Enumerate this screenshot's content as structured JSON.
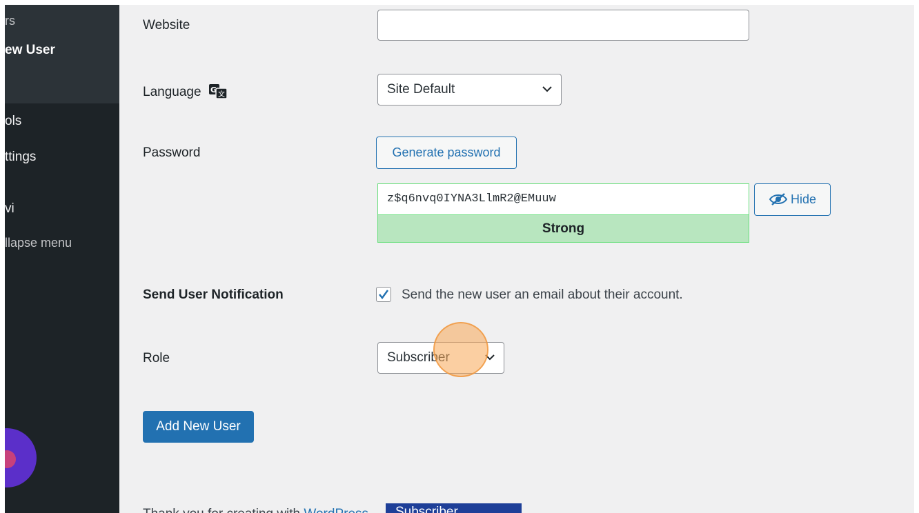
{
  "sidebar": {
    "items": [
      {
        "label": "rs"
      },
      {
        "label": "ew User"
      },
      {
        "label": "ols"
      },
      {
        "label": "ttings"
      },
      {
        "label": "vi"
      },
      {
        "label": "llapse menu"
      }
    ]
  },
  "form": {
    "website": {
      "label": "Website",
      "value": ""
    },
    "language": {
      "label": "Language",
      "selected": "Site Default"
    },
    "password": {
      "label": "Password",
      "generate_label": "Generate password",
      "value": "z$q6nvq0IYNA3LlmR2@EMuuw",
      "hide_label": "Hide",
      "strength": "Strong"
    },
    "notification": {
      "label": "Send User Notification",
      "checked": true,
      "text": "Send the new user an email about their account."
    },
    "role": {
      "label": "Role",
      "selected": "Subscriber"
    },
    "submit_label": "Add New User"
  },
  "footer": {
    "text_partial": "Thank you for creating with ",
    "link_partial": "WordPress",
    "dropdown_peek": "Subscriber"
  },
  "colors": {
    "primary": "#2271b1",
    "sidebar_bg": "#1d2327",
    "strength_bg": "#b8e6bf",
    "click_indicator": "#f8a856"
  }
}
